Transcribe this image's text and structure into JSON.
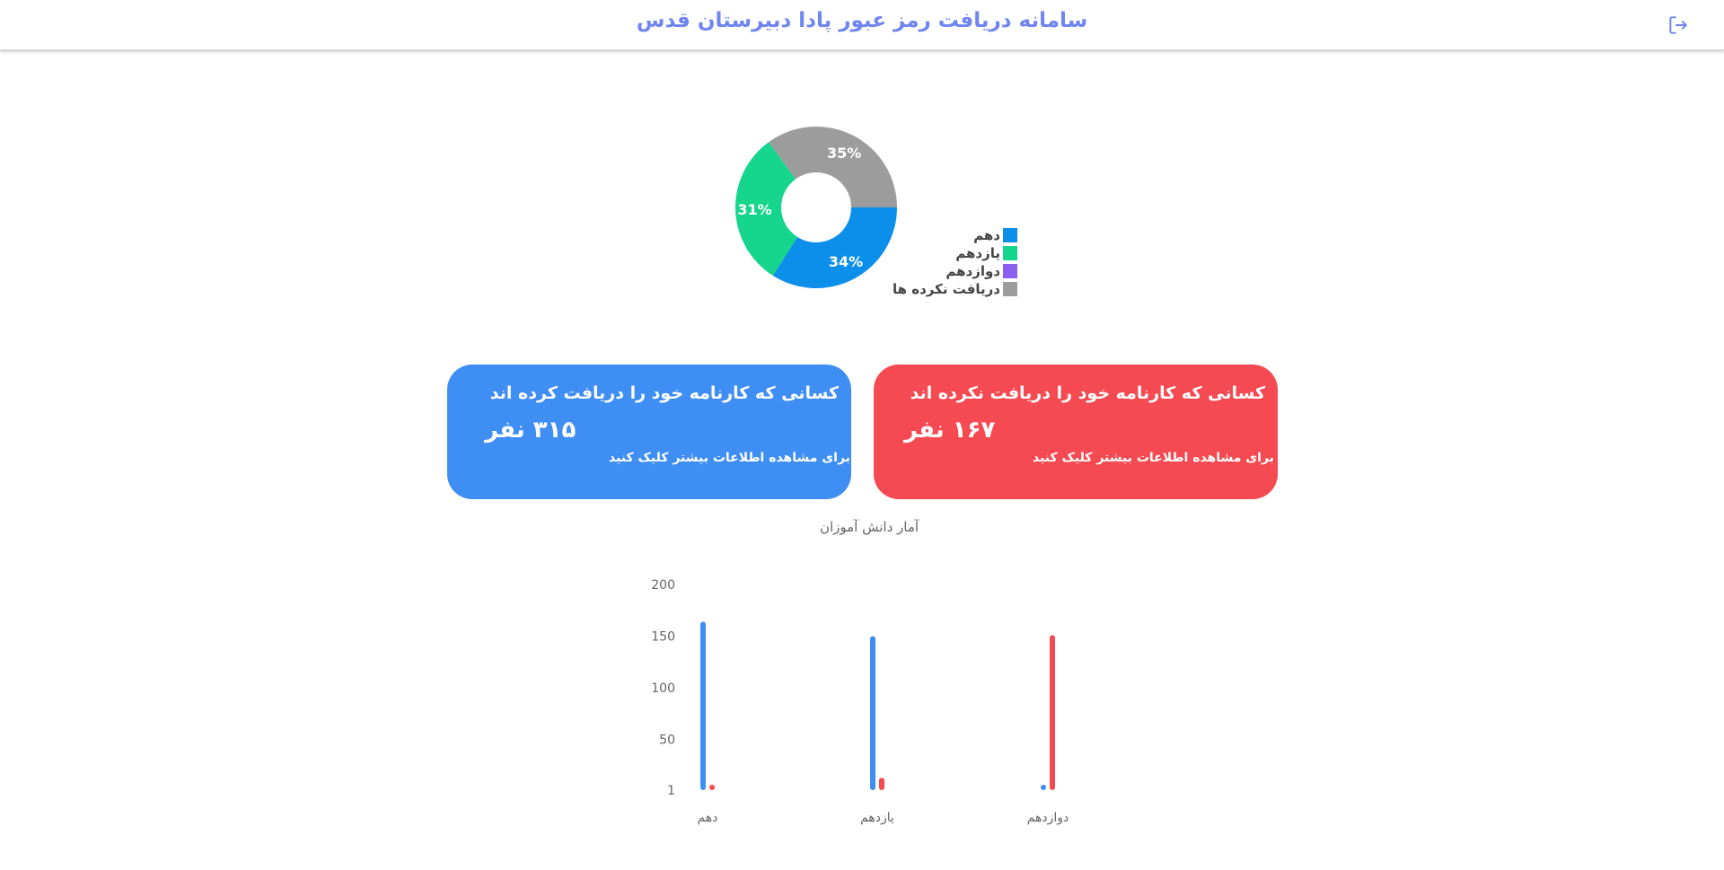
{
  "header": {
    "title": "سامانه دریافت رمز عبور پادا دبیرستان قدس",
    "logout_icon": "logout-icon"
  },
  "colors": {
    "header_title": "#6f85f0",
    "blue": "#3e8ef3",
    "red": "#f54a51",
    "donut_blue": "#0b8fea",
    "donut_green": "#16d58d",
    "donut_purple": "#8b60ee",
    "donut_gray": "#9c9c9c"
  },
  "cards": {
    "received": {
      "title": "کسانی که کارنامه خود را دریافت کرده اند",
      "count": "۳۱۵ نفر",
      "hint": "برای مشاهده اطلاعات بیشتر کلیک کنید"
    },
    "not_received": {
      "title": "کسانی که کارنامه خود را دریافت نکرده اند",
      "count": "۱۶۷ نفر",
      "hint": "برای مشاهده اطلاعات بیشتر کلیک کنید"
    }
  },
  "chart_data": [
    {
      "type": "pie",
      "variant": "donut",
      "legend_position": "right",
      "categories": [
        "دهم",
        "یازدهم",
        "دوازدهم",
        "دریافت نکرده ها"
      ],
      "values": [
        34,
        31,
        0,
        35
      ],
      "labels": [
        "34%",
        "31%",
        "",
        "35%"
      ],
      "colors": [
        "#0b8fea",
        "#16d58d",
        "#8b60ee",
        "#9c9c9c"
      ]
    },
    {
      "type": "bar",
      "title": "آمار دانش آموزان",
      "categories": [
        "دهم",
        "یازدهم",
        "دوازدهم"
      ],
      "series": [
        {
          "values": [
            164,
            150,
            2
          ],
          "color": "#3e8ef3"
        },
        {
          "values": [
            4,
            13,
            151
          ],
          "color": "#f54a51"
        }
      ],
      "yticks": [
        "1",
        "50",
        "100",
        "150",
        "200"
      ],
      "ylim": [
        1,
        200
      ],
      "grid": false
    }
  ]
}
